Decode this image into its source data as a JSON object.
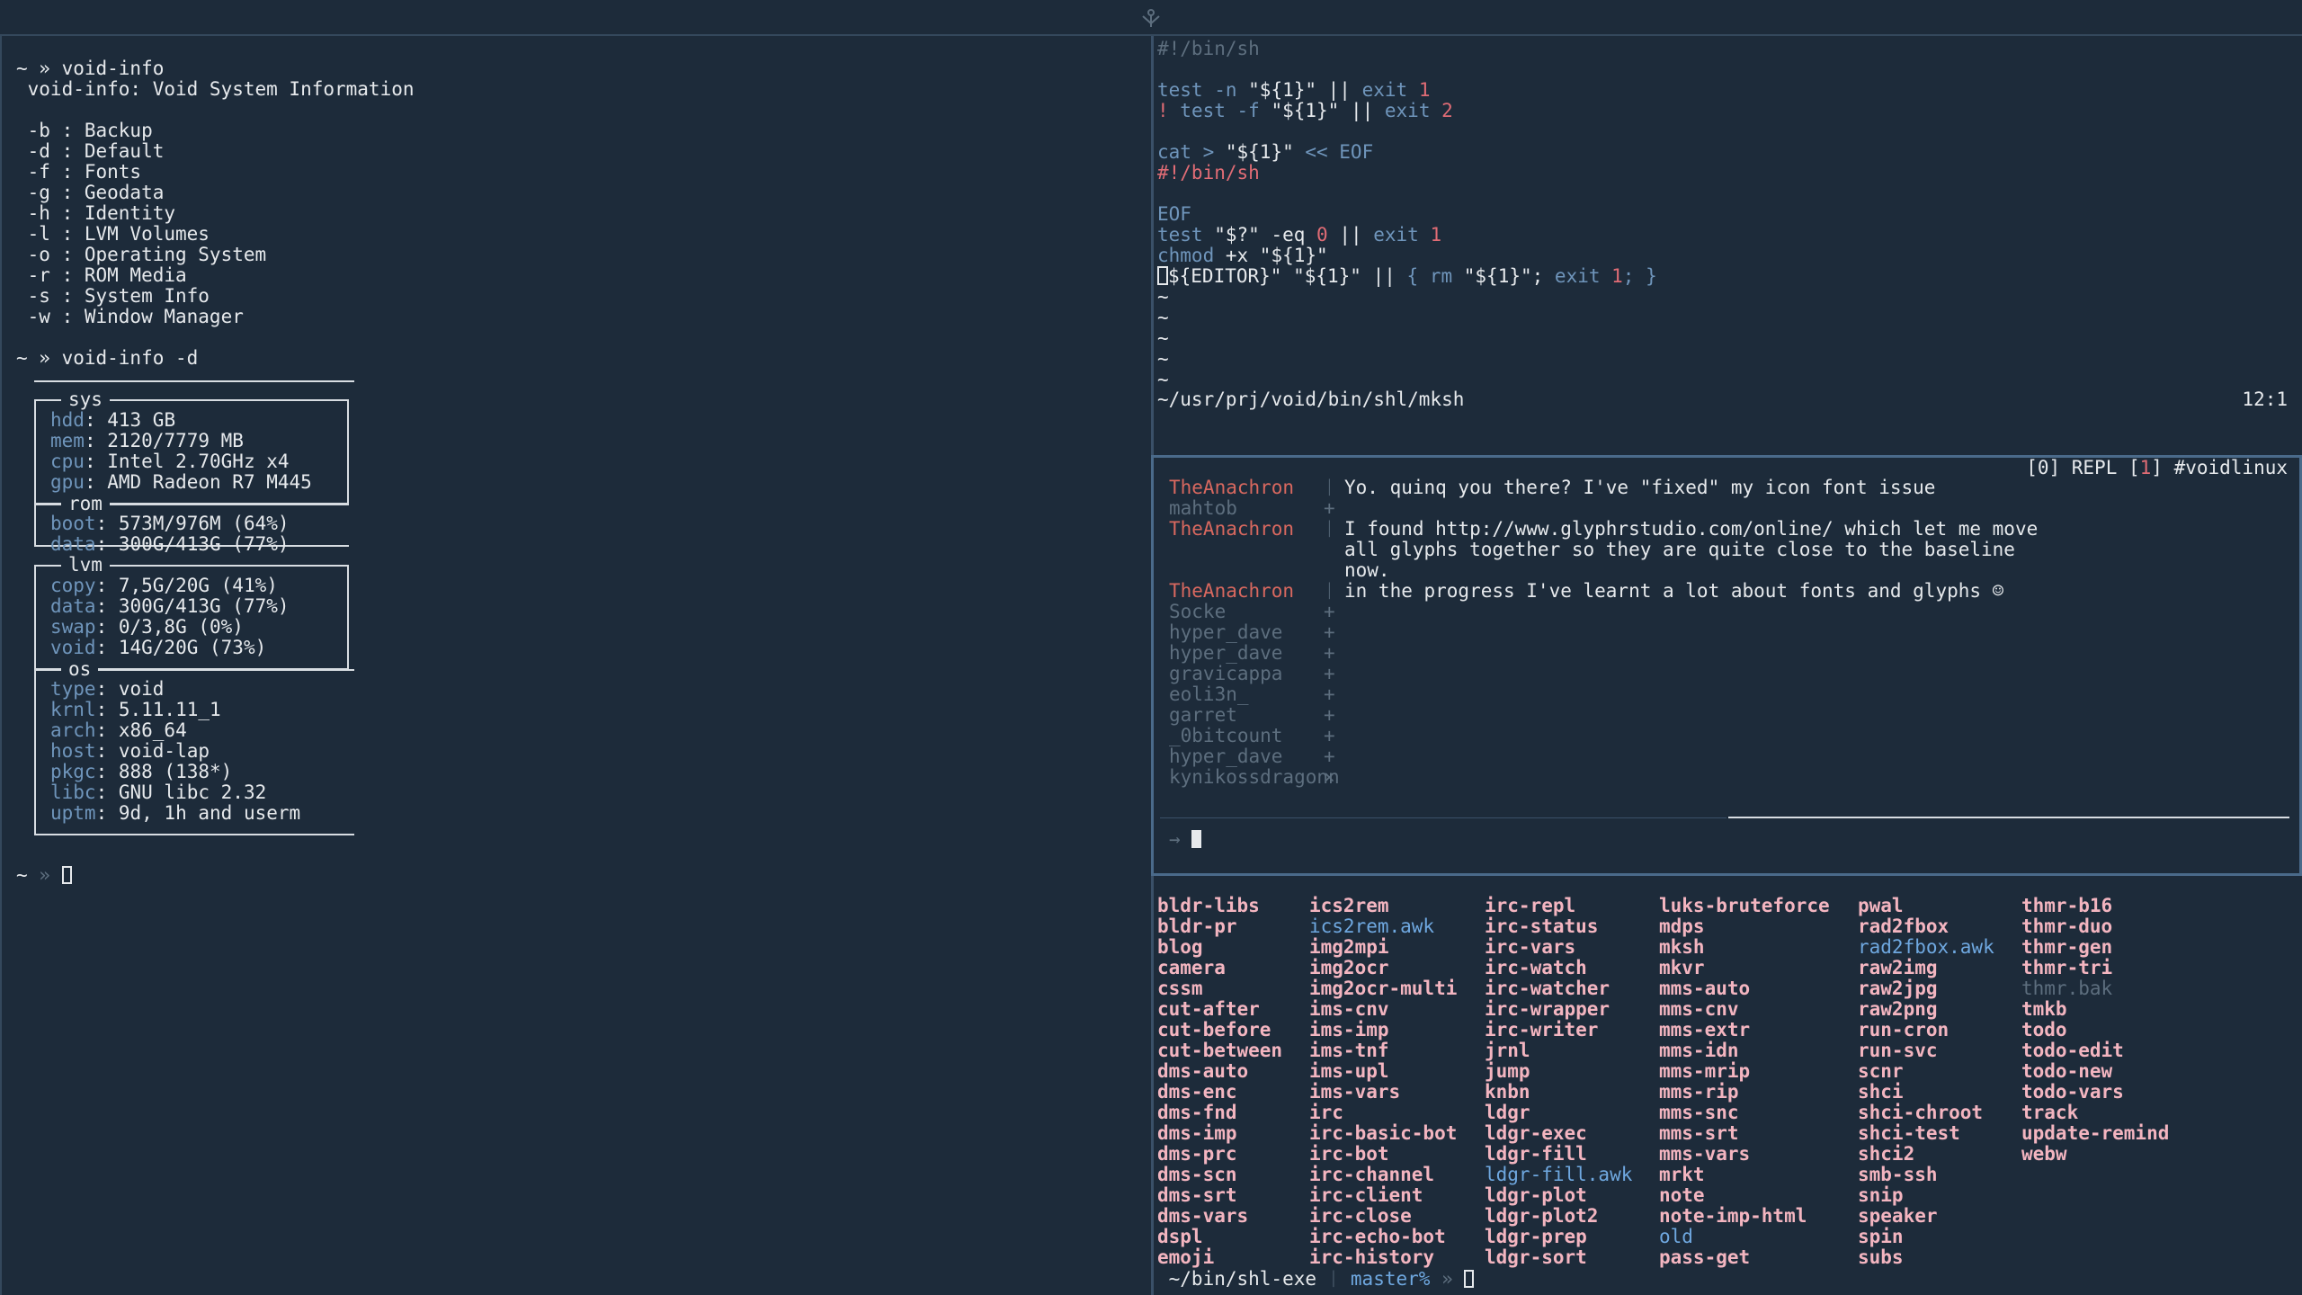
{
  "topbar": {
    "icon": "dock-anchor-icon"
  },
  "left": {
    "prompt1": "~ » void-info",
    "title": " void-info: Void System Information",
    "options": [
      " -b : Backup",
      " -d : Default",
      " -f : Fonts",
      " -g : Geodata",
      " -h : Identity",
      " -l : LVM Volumes",
      " -o : Operating System",
      " -r : ROM Media",
      " -s : System Info",
      " -w : Window Manager"
    ],
    "prompt2": "~ » void-info -d",
    "sys_title": "sys",
    "sys": [
      {
        "k": "hdd",
        "v": ": 413 GB"
      },
      {
        "k": "mem",
        "v": ": 2120/7779 MB"
      },
      {
        "k": "cpu",
        "v": ": Intel 2.70GHz x4"
      },
      {
        "k": "gpu",
        "v": ": AMD Radeon R7 M445"
      }
    ],
    "rom_title": "rom",
    "rom": [
      {
        "k": "boot",
        "v": ": 573M/976M (64%)"
      },
      {
        "k": "data",
        "v": ": 300G/413G (77%)"
      }
    ],
    "lvm_title": "lvm",
    "lvm": [
      {
        "k": "copy",
        "v": ": 7,5G/20G (41%)"
      },
      {
        "k": "data",
        "v": ": 300G/413G (77%)"
      },
      {
        "k": "swap",
        "v": ": 0/3,8G (0%)"
      },
      {
        "k": "void",
        "v": ": 14G/20G (73%)"
      }
    ],
    "os_title": "os",
    "os": [
      {
        "k": "type",
        "v": ": void"
      },
      {
        "k": "krnl",
        "v": ": 5.11.11_1"
      },
      {
        "k": "arch",
        "v": ": x86_64"
      },
      {
        "k": "host",
        "v": ": void-lap"
      },
      {
        "k": "pkgc",
        "v": ": 888 (138*)"
      },
      {
        "k": "libc",
        "v": ": GNU libc 2.32"
      },
      {
        "k": "uptm",
        "v": ": 9d, 1h and userm"
      }
    ],
    "prompt3_tilde": "~",
    "prompt3_arrow": " » "
  },
  "editor": {
    "shebang_dim": "#!/bin/sh",
    "l1": {
      "a": "test -n ",
      "b": "\"${1}\"",
      "c": " || ",
      "d": "exit ",
      "e": "1"
    },
    "l2": {
      "a": "! ",
      "b": "test -f ",
      "c": "\"${1}\"",
      "d": " || ",
      "e": "exit ",
      "f": "2"
    },
    "l3": {
      "a": "cat > ",
      "b": "\"${1}\"",
      "c": " << EOF"
    },
    "l4": "#!/bin/sh",
    "l5": "EOF",
    "l6": {
      "a": "test ",
      "b": "\"$?\"",
      "c": " -eq ",
      "d": "0",
      "e": " || ",
      "f": "exit ",
      "g": "1"
    },
    "l7": {
      "a": "chmod ",
      "b": "+x ",
      "c": "\"${1}\""
    },
    "l8": {
      "a": "${EDITOR}\"",
      "b": " \"${1}\"",
      "c": " || ",
      "d": "{ ",
      "e": "rm ",
      "f": "\"${1}\"",
      "g": "; ",
      "h": "exit ",
      "i": "1",
      "j": "; }"
    },
    "tilde": "~",
    "status_path": "~/usr/prj/void/bin/shl/mksh",
    "status_pos": "12:1"
  },
  "chat": {
    "status": {
      "a": "[0] REPL [",
      "b": "1",
      "c": "] #voidlinux"
    },
    "messages": [
      {
        "nick": "TheAnachron",
        "sym": "ᛁ",
        "text": "Yo. quinq you there? I've \"fixed\" my icon font issue",
        "hi": true
      },
      {
        "nick": "mahtob",
        "sym": "+",
        "text": "",
        "hi": false
      },
      {
        "nick": "TheAnachron",
        "sym": "ᛁ",
        "text": "I found http://www.glyphrstudio.com/online/ which let me move",
        "hi": true
      },
      {
        "nick": "",
        "sym": "",
        "text": "all glyphs together so they are quite close to the baseline",
        "hi": false
      },
      {
        "nick": "",
        "sym": "",
        "text": "now.",
        "hi": false
      },
      {
        "nick": "TheAnachron",
        "sym": "ᛁ",
        "text": "in the progress I've learnt a lot about fonts and glyphs ☺",
        "hi": true
      },
      {
        "nick": "Socke",
        "sym": "+",
        "text": "",
        "hi": false
      },
      {
        "nick": "hyper_dave",
        "sym": "+",
        "text": "",
        "hi": false
      },
      {
        "nick": "hyper_dave",
        "sym": "+",
        "text": "",
        "hi": false
      },
      {
        "nick": "gravicappa",
        "sym": "+",
        "text": "",
        "hi": false
      },
      {
        "nick": "eoli3n_",
        "sym": "+",
        "text": "",
        "hi": false
      },
      {
        "nick": "garret",
        "sym": "+",
        "text": "",
        "hi": false
      },
      {
        "nick": "_0bitcount",
        "sym": "+",
        "text": "",
        "hi": false
      },
      {
        "nick": "hyper_dave",
        "sym": "+",
        "text": "",
        "hi": false
      },
      {
        "nick": "kynikossdragonn",
        "sym": "×",
        "text": "",
        "hi": false
      }
    ],
    "input_arrow": "→"
  },
  "ls": {
    "columns": [
      [
        "bldr-libs",
        "bldr-pr",
        "blog",
        "camera",
        "cssm",
        "cut-after",
        "cut-before",
        "cut-between",
        "dms-auto",
        "dms-enc",
        "dms-fnd",
        "dms-imp",
        "dms-prc",
        "dms-scn",
        "dms-srt",
        "dms-vars",
        "dspl",
        "emoji"
      ],
      [
        "ics2rem",
        "ics2rem.awk",
        "img2mpi",
        "img2ocr",
        "img2ocr-multi",
        "ims-cnv",
        "ims-imp",
        "ims-tnf",
        "ims-upl",
        "ims-vars",
        "irc",
        "irc-basic-bot",
        "irc-bot",
        "irc-channel",
        "irc-client",
        "irc-close",
        "irc-echo-bot",
        "irc-history"
      ],
      [
        "irc-repl",
        "irc-status",
        "irc-vars",
        "irc-watch",
        "irc-watcher",
        "irc-wrapper",
        "irc-writer",
        "jrnl",
        "jump",
        "knbn",
        "ldgr",
        "ldgr-exec",
        "ldgr-fill",
        "ldgr-fill.awk",
        "ldgr-plot",
        "ldgr-plot2",
        "ldgr-prep",
        "ldgr-sort"
      ],
      [
        "luks-bruteforce",
        "mdps",
        "mksh",
        "mkvr",
        "mms-auto",
        "mms-cnv",
        "mms-extr",
        "mms-idn",
        "mms-mrip",
        "mms-rip",
        "mms-snc",
        "mms-srt",
        "mms-vars",
        "mrkt",
        "note",
        "note-imp-html",
        "old",
        "pass-get"
      ],
      [
        "pwal",
        "rad2fbox",
        "rad2fbox.awk",
        "raw2img",
        "raw2jpg",
        "raw2png",
        "run-cron",
        "run-svc",
        "scnr",
        "shci",
        "shci-chroot",
        "shci-test",
        "shci2",
        "smb-ssh",
        "snip",
        "speaker",
        "spin",
        "subs"
      ],
      [
        "thmr-b16",
        "thmr-duo",
        "thmr-gen",
        "thmr-tri",
        "thmr.bak",
        "tmkb",
        "todo",
        "todo-edit",
        "todo-new",
        "todo-vars",
        "track",
        "update-remind",
        "webw"
      ]
    ],
    "blue_items": [
      "ics2rem.awk",
      "ldgr-fill.awk",
      "rad2fbox.awk",
      "old"
    ],
    "dim_items": [
      "thmr.bak"
    ],
    "prompt_path": " ~/bin/shl-exe ",
    "prompt_sep": "ᛁ",
    "prompt_branch": " master%",
    "prompt_arrow": " » "
  }
}
